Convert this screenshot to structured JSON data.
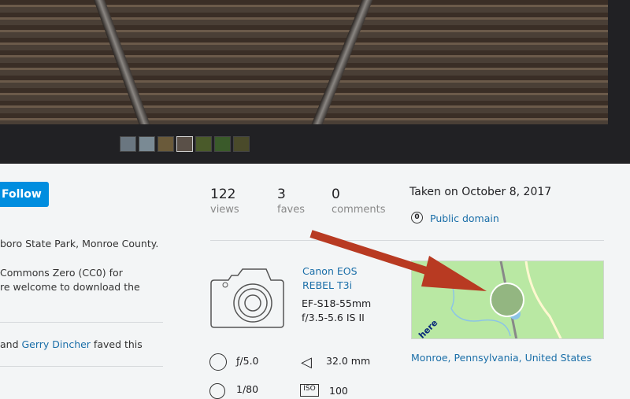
{
  "follow_label": "Follow",
  "description": [
    "boro State Park, Monroe County.",
    "Commons Zero (CC0) for",
    "re welcome to download the"
  ],
  "faved": {
    "prefix": "and ",
    "user": "Gerry Dincher",
    "suffix": " faved this"
  },
  "stats": [
    {
      "value": "122",
      "label": "views"
    },
    {
      "value": "3",
      "label": "faves"
    },
    {
      "value": "0",
      "label": "comments"
    }
  ],
  "taken": "Taken on October 8, 2017",
  "license": "Public domain",
  "camera": {
    "model_line1": "Canon EOS",
    "model_line2": "REBEL T3i",
    "lens_line1": "EF-S18-55mm",
    "lens_line2": "f/3.5-5.6 IS II"
  },
  "exif": {
    "aperture": "ƒ/5.0",
    "focal": "32.0 mm",
    "shutter": "1/80",
    "iso": "100"
  },
  "map": {
    "brand": "here"
  },
  "location": "Monroe, Pennsylvania, United States",
  "colors": {
    "accent": "#008ddf",
    "link": "#1a6ea8",
    "arrow": "#b83a22"
  }
}
